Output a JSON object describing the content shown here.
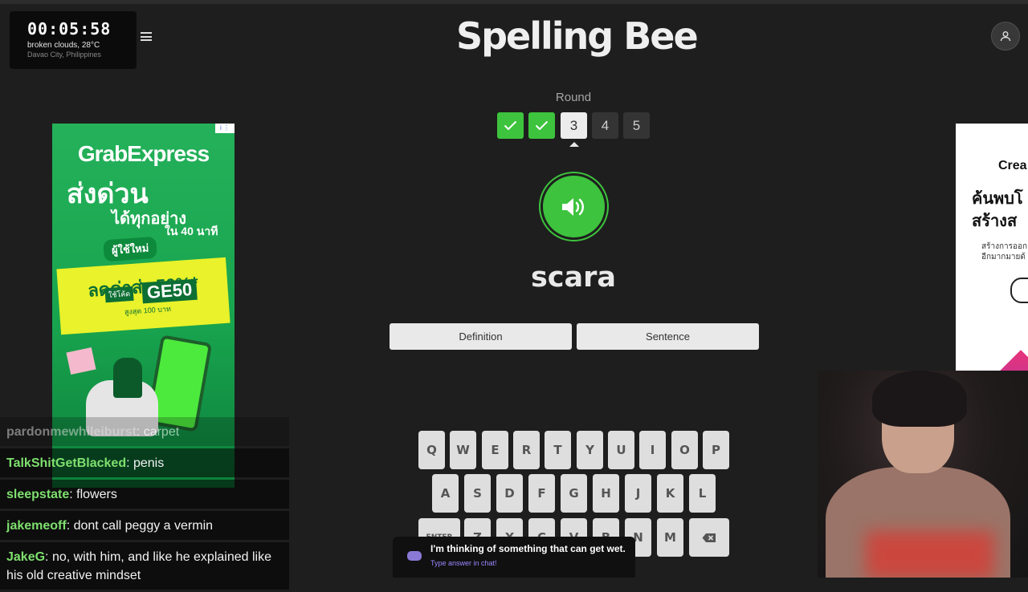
{
  "clock": {
    "time": "00:05:58",
    "weather": "broken clouds, 28°C",
    "location": "Davao City, Philippines"
  },
  "game": {
    "title": "Spelling Bee",
    "round_label": "Round",
    "rounds": [
      {
        "label": "",
        "state": "done"
      },
      {
        "label": "",
        "state": "done"
      },
      {
        "label": "3",
        "state": "current"
      },
      {
        "label": "4",
        "state": "todo"
      },
      {
        "label": "5",
        "state": "todo"
      }
    ],
    "typed_word": "scara",
    "definition_label": "Definition",
    "sentence_label": "Sentence",
    "keyboard": {
      "row1": [
        "Q",
        "W",
        "E",
        "R",
        "T",
        "Y",
        "U",
        "I",
        "O",
        "P"
      ],
      "row2": [
        "A",
        "S",
        "D",
        "F",
        "G",
        "H",
        "J",
        "K",
        "L"
      ],
      "row3": [
        "ENTER",
        "Z",
        "X",
        "C",
        "V",
        "B",
        "N",
        "M"
      ]
    }
  },
  "ad_left": {
    "brand": "GrabExpress",
    "headline": "ส่งด่วน",
    "sub": "ได้ทุกอย่าง",
    "sub2": "ใน 40 นาที",
    "tag": "ผู้ใช้ใหม่",
    "discount": "ลดค่าส่ง 50%*",
    "code_label": "ใช้โค้ด",
    "code": "GE50",
    "cap": "สูงสุด 100 บาท"
  },
  "ad_right": {
    "brand": "Crea",
    "headline_1": "ค้นพบโ",
    "headline_2": "สร้างส",
    "body_1": "สร้างการออกแ",
    "body_2": "อีกมากมายด้"
  },
  "chat": [
    {
      "user": "pardonmewhileiburst",
      "text": ": carpet",
      "color": "#bdbdbd"
    },
    {
      "user": "TalkShitGetBlacked",
      "text": ": penis",
      "color": "#7ee06e"
    },
    {
      "user": "sleepstate",
      "text": ": flowers",
      "color": "#7ee06e"
    },
    {
      "user": "jakemeoff",
      "text": ": dont call peggy a vermin",
      "color": "#7ee06e"
    },
    {
      "user": "JakeG",
      "text": ": no, with him, and like he explained like his old creative mindset",
      "color": "#7ee06e"
    }
  ],
  "toast": {
    "message": "I'm thinking of something that can get wet.",
    "sub": "Type answer in chat!"
  },
  "colors": {
    "accent_green": "#3dc33d",
    "background": "#1e1e1e"
  }
}
